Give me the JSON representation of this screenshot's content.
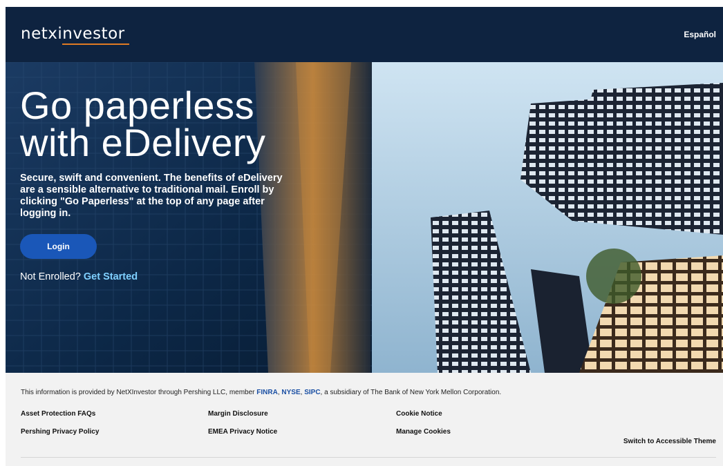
{
  "header": {
    "logo_text": "netxinvestor",
    "language_link": "Español",
    "colors": {
      "background": "#0e2340",
      "logo_accent": "#e07b24"
    }
  },
  "hero": {
    "title": "Go paperless\nwith eDelivery",
    "description": "Secure, swift and convenient. The benefits of eDelivery are a sensible alternative to traditional mail. Enroll by clicking \"Go Paperless\" at the top of any page after logging in.",
    "login_button": "Login",
    "enroll_prompt": "Not Enrolled?",
    "enroll_link": "Get Started",
    "colors": {
      "button": "#1a57b8",
      "link": "#7fd0ff"
    }
  },
  "footer": {
    "disclaimer_prefix": "This information is provided by NetXInvestor through Pershing LLC, member",
    "disclaimer_links": [
      "FINRA",
      "NYSE",
      "SIPC"
    ],
    "disclaimer_suffix": ", a subsidiary of The Bank of New York Mellon Corporation.",
    "links": {
      "asset_protection": "Asset Protection FAQs",
      "privacy_policy": "Pershing Privacy Policy",
      "margin_disclosure": "Margin Disclosure",
      "emea_privacy": "EMEA Privacy Notice",
      "cookie_notice": "Cookie Notice",
      "manage_cookies": "Manage Cookies",
      "accessible_theme": "Switch to Accessible Theme"
    }
  }
}
